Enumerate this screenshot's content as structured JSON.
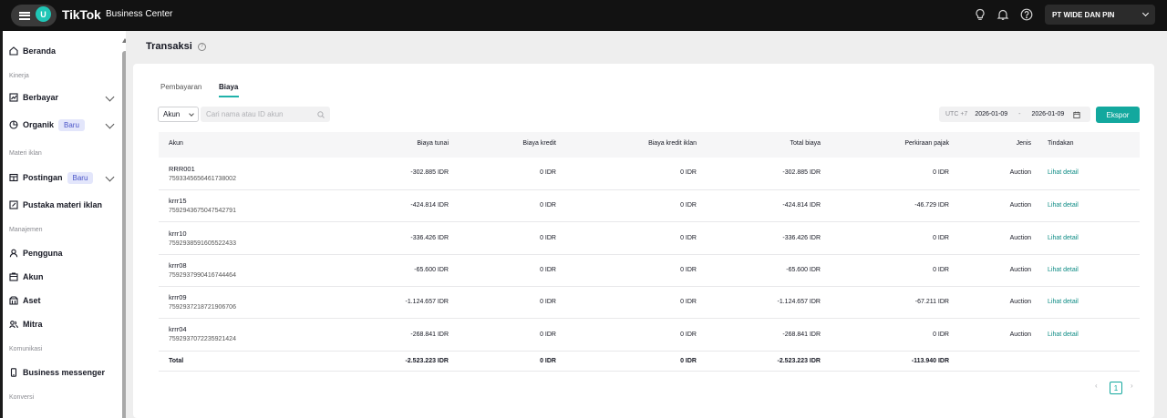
{
  "topbar": {
    "avatar_letter": "U",
    "brand": "TikTok",
    "brand_sub": "Business Center",
    "account_name": "PT WIDE DAN PIN"
  },
  "sidebar": {
    "home": "Beranda",
    "section_kinerja": "Kinerja",
    "berbayar": "Berbayar",
    "organik": "Organik",
    "organik_badge": "Baru",
    "section_materi": "Materi iklan",
    "postingan": "Postingan",
    "postingan_badge": "Baru",
    "pustaka": "Pustaka materi iklan",
    "section_manajemen": "Manajemen",
    "pengguna": "Pengguna",
    "akun": "Akun",
    "aset": "Aset",
    "mitra": "Mitra",
    "section_komunikasi": "Komunikasi",
    "business_messenger": "Business messenger",
    "section_konversi": "Konversi"
  },
  "page": {
    "title": "Transaksi",
    "tabs": [
      {
        "label": "Pembayaran",
        "active": false
      },
      {
        "label": "Biaya",
        "active": true
      }
    ]
  },
  "filters": {
    "select_value": "Akun",
    "search_placeholder": "Cari nama atau ID akun",
    "timezone": "UTC +7",
    "date_start": "2026-01-09",
    "date_sep": "-",
    "date_end": "2026-01-09",
    "export_label": "Ekspor"
  },
  "table": {
    "headers": {
      "akun": "Akun",
      "biaya_tunai": "Biaya tunai",
      "biaya_kredit": "Biaya kredit",
      "biaya_kredit_iklan": "Biaya kredit iklan",
      "total_biaya": "Total biaya",
      "perkiraan_pajak": "Perkiraan pajak",
      "jenis": "Jenis",
      "tindakan": "Tindakan"
    },
    "rows": [
      {
        "name": "RRR001",
        "id": "7593345656461738002",
        "tunai": "-302.885 IDR",
        "kredit": "0 IDR",
        "kredit_iklan": "0 IDR",
        "total": "-302.885 IDR",
        "pajak": "0 IDR",
        "jenis": "Auction",
        "action": "Lihat detail"
      },
      {
        "name": "krrr15",
        "id": "7592943675047542791",
        "tunai": "-424.814 IDR",
        "kredit": "0 IDR",
        "kredit_iklan": "0 IDR",
        "total": "-424.814 IDR",
        "pajak": "-46.729 IDR",
        "jenis": "Auction",
        "action": "Lihat detail"
      },
      {
        "name": "krrr10",
        "id": "7592938591605522433",
        "tunai": "-336.426 IDR",
        "kredit": "0 IDR",
        "kredit_iklan": "0 IDR",
        "total": "-336.426 IDR",
        "pajak": "0 IDR",
        "jenis": "Auction",
        "action": "Lihat detail"
      },
      {
        "name": "krrr08",
        "id": "7592937990416744464",
        "tunai": "-65.600 IDR",
        "kredit": "0 IDR",
        "kredit_iklan": "0 IDR",
        "total": "-65.600 IDR",
        "pajak": "0 IDR",
        "jenis": "Auction",
        "action": "Lihat detail"
      },
      {
        "name": "krrr09",
        "id": "7592937218721906706",
        "tunai": "-1.124.657 IDR",
        "kredit": "0 IDR",
        "kredit_iklan": "0 IDR",
        "total": "-1.124.657 IDR",
        "pajak": "-67.211 IDR",
        "jenis": "Auction",
        "action": "Lihat detail"
      },
      {
        "name": "krrr04",
        "id": "7592937072235921424",
        "tunai": "-268.841 IDR",
        "kredit": "0 IDR",
        "kredit_iklan": "0 IDR",
        "total": "-268.841 IDR",
        "pajak": "0 IDR",
        "jenis": "Auction",
        "action": "Lihat detail"
      }
    ],
    "total": {
      "label": "Total",
      "tunai": "-2.523.223 IDR",
      "kredit": "0 IDR",
      "kredit_iklan": "0 IDR",
      "total": "-2.523.223 IDR",
      "pajak": "-113.940 IDR"
    }
  },
  "pagination": {
    "prev": "‹",
    "current": "1",
    "next": "›"
  },
  "colors": {
    "accent": "#13a89e",
    "topbar": "#121212",
    "link": "#0f8c85"
  }
}
